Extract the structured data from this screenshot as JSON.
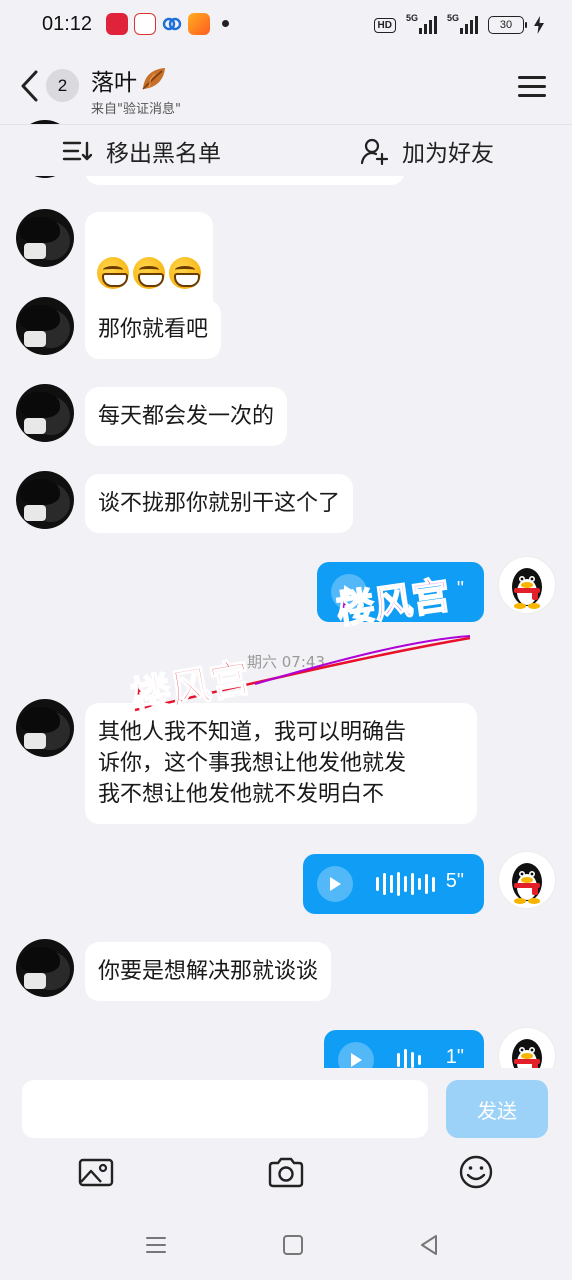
{
  "status_bar": {
    "time": "01:12",
    "hd_label": "HD",
    "net1": "5G",
    "net2": "5G",
    "battery": "30"
  },
  "header": {
    "unread_count": "2",
    "contact_name": "落叶",
    "subtitle": "来自\"验证消息\""
  },
  "actions": {
    "remove_blacklist": "移出黑名单",
    "add_friend": "加为好友"
  },
  "messages": {
    "m1": "那你就看吧",
    "m2": "每天都会发一次的",
    "m3": "谈不拢那你就别干这个了",
    "m4": "其他人我不知道，我可以明确告\n诉你，这个事我想让他发他就发\n我不想让他发他就不发明白不",
    "m5": "你要是想解决那就谈谈"
  },
  "voice": {
    "v1_duration": "\"",
    "v2_duration": "5\"",
    "v3_duration": "1\""
  },
  "timestamp": "期六 07:43",
  "watermark": "楼风宫",
  "input": {
    "placeholder": "",
    "send_label": "发送"
  },
  "colors": {
    "accent": "#109df5",
    "send_disabled": "#9dd2f8",
    "background": "#f2f2f6",
    "watermark_red": "#e8102a",
    "watermark_purple": "#b000d8"
  }
}
